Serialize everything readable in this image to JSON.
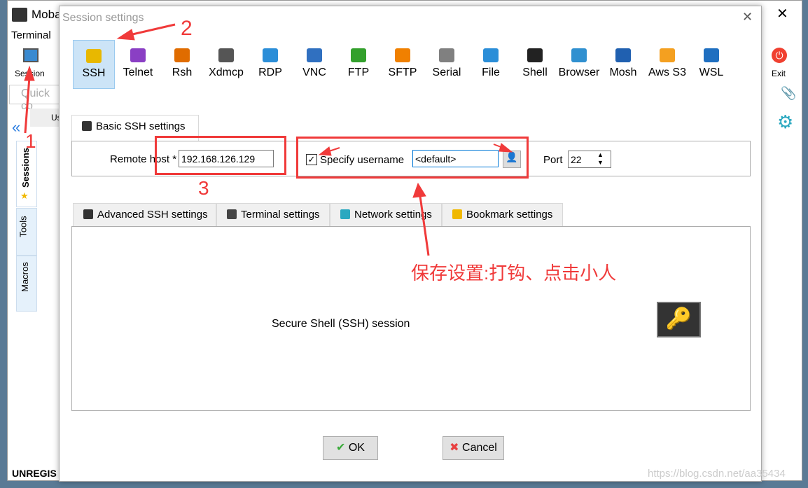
{
  "app": {
    "title": "Moba",
    "menu_terminal": "Terminal",
    "session_button": "Session",
    "quick_connect_placeholder": "Quick co",
    "user_sessions": "Us",
    "side_tabs": [
      "Sessions",
      "Tools",
      "Macros"
    ],
    "status": "UNREGIS",
    "exit_label": "Exit"
  },
  "dialog": {
    "title": "Session settings",
    "protocols": [
      {
        "label": "SSH",
        "color": "#e8b800"
      },
      {
        "label": "Telnet",
        "color": "#8a3fc4"
      },
      {
        "label": "Rsh",
        "color": "#e06c00"
      },
      {
        "label": "Xdmcp",
        "color": "#555555"
      },
      {
        "label": "RDP",
        "color": "#2b8ed8"
      },
      {
        "label": "VNC",
        "color": "#3070c0"
      },
      {
        "label": "FTP",
        "color": "#33a02c"
      },
      {
        "label": "SFTP",
        "color": "#f08000"
      },
      {
        "label": "Serial",
        "color": "#808080"
      },
      {
        "label": "File",
        "color": "#2b8ed8"
      },
      {
        "label": "Shell",
        "color": "#222222"
      },
      {
        "label": "Browser",
        "color": "#3090d0"
      },
      {
        "label": "Mosh",
        "color": "#2060b0"
      },
      {
        "label": "Aws S3",
        "color": "#f4a020"
      },
      {
        "label": "WSL",
        "color": "#1f6fc0"
      }
    ],
    "basic_tab": "Basic SSH settings",
    "remote_host_label": "Remote host *",
    "remote_host_value": "192.168.126.129",
    "specify_username_label": "Specify username",
    "specify_username_checked": true,
    "username_value": "<default>",
    "port_label": "Port",
    "port_value": "22",
    "lower_tabs": [
      "Advanced SSH settings",
      "Terminal settings",
      "Network settings",
      "Bookmark settings"
    ],
    "description": "Secure Shell (SSH) session",
    "ok_label": "OK",
    "cancel_label": "Cancel"
  },
  "annotations": {
    "n1": "1",
    "n2": "2",
    "n3": "3",
    "note": "保存设置:打钩、点击小人",
    "color": "#f03a3a"
  },
  "watermark": "https://blog.csdn.net/aa35434"
}
